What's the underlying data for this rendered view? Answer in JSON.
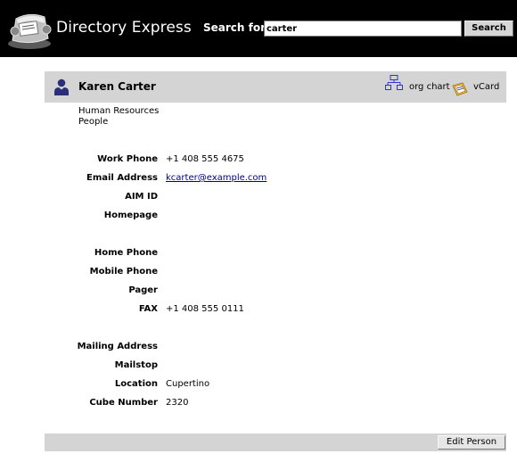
{
  "header": {
    "app_title": "Directory Express",
    "search_label": "Search for:",
    "search_value": "carter",
    "search_button": "Search",
    "logo_icon": "rolodex-icon"
  },
  "person": {
    "name": "Karen Carter",
    "department": "Human Resources",
    "group": "People",
    "org_chart_label": "org chart",
    "vcard_label": "vCard"
  },
  "fields": {
    "work_phone": {
      "label": "Work Phone",
      "value": "+1 408 555 4675"
    },
    "email": {
      "label": "Email Address",
      "value": "kcarter@example.com"
    },
    "aim": {
      "label": "AIM ID",
      "value": ""
    },
    "homepage": {
      "label": "Homepage",
      "value": ""
    },
    "home_phone": {
      "label": "Home Phone",
      "value": ""
    },
    "mobile_phone": {
      "label": "Mobile Phone",
      "value": ""
    },
    "pager": {
      "label": "Pager",
      "value": ""
    },
    "fax": {
      "label": "FAX",
      "value": "+1 408 555 0111"
    },
    "mailing_address": {
      "label": "Mailing Address",
      "value": ""
    },
    "mailstop": {
      "label": "Mailstop",
      "value": ""
    },
    "location": {
      "label": "Location",
      "value": "Cupertino"
    },
    "cube_number": {
      "label": "Cube Number",
      "value": "2320"
    }
  },
  "footer": {
    "edit_button": "Edit Person"
  },
  "colors": {
    "header_bg": "#000000",
    "bar_bg": "#d4d4d4",
    "link": "#00008b",
    "person_icon": "#2b2f7a"
  }
}
